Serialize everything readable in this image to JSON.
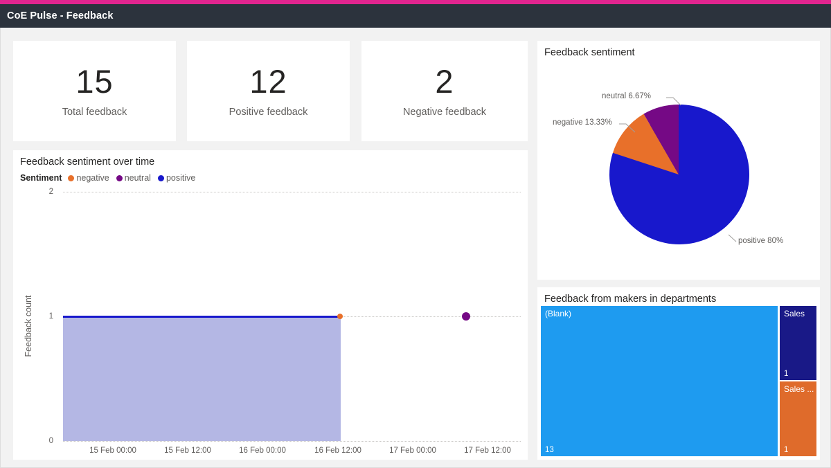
{
  "window": {
    "title": "CoE Pulse - Feedback",
    "accent_color": "#e2258f",
    "titlebar_color": "#2c333d"
  },
  "colors": {
    "negative": "#E8702A",
    "neutral": "#750985",
    "positive": "#1818CC",
    "area_fill": "#9fa3dd",
    "treemap_blank": "#1E9BF0",
    "treemap_sales": "#191987",
    "treemap_sales_other": "#DF6B2B",
    "page_background": "#f2f2f2"
  },
  "kpis": [
    {
      "value": "15",
      "label": "Total feedback",
      "name": "total-feedback"
    },
    {
      "value": "12",
      "label": "Positive feedback",
      "name": "positive-feedback"
    },
    {
      "value": "2",
      "label": "Negative feedback",
      "name": "negative-feedback"
    }
  ],
  "over_time": {
    "title": "Feedback sentiment over time",
    "legend_title": "Sentiment",
    "legend": [
      {
        "label": "negative",
        "color": "#E8702A"
      },
      {
        "label": "neutral",
        "color": "#750985"
      },
      {
        "label": "positive",
        "color": "#1818CC"
      }
    ]
  },
  "pie": {
    "title": "Feedback sentiment",
    "labels": {
      "neutral": "neutral 6.67%",
      "negative": "negative 13.33%",
      "positive": "positive 80%"
    }
  },
  "treemap": {
    "title": "Feedback from makers in departments"
  },
  "chart_data": [
    {
      "id": "feedback-sentiment-over-time",
      "type": "area",
      "title": "Feedback sentiment over time",
      "xlabel": "",
      "ylabel": "Feedback count",
      "ylim": [
        0,
        2
      ],
      "yticks": [
        "0",
        "1",
        "2"
      ],
      "xticks": [
        "15 Feb 00:00",
        "15 Feb 12:00",
        "16 Feb 00:00",
        "16 Feb 12:00",
        "17 Feb 00:00",
        "17 Feb 12:00"
      ],
      "grid": true,
      "legend_position": "top-left",
      "series": [
        {
          "name": "negative",
          "color": "#E8702A",
          "points": [
            {
              "x": "16 Feb 12:00",
              "y": 1
            }
          ]
        },
        {
          "name": "neutral",
          "color": "#750985",
          "points": [
            {
              "x": "17 Feb 12:00",
              "y": 1
            }
          ]
        },
        {
          "name": "positive",
          "color": "#1818CC",
          "points": [
            {
              "x": "14 Feb 18:00",
              "y": 1
            },
            {
              "x": "16 Feb 12:00",
              "y": 1
            }
          ]
        }
      ]
    },
    {
      "id": "feedback-sentiment-pie",
      "type": "pie",
      "title": "Feedback sentiment",
      "categories": [
        "positive",
        "negative",
        "neutral"
      ],
      "values": [
        80,
        13.33,
        6.67
      ],
      "value_labels": [
        "positive 80%",
        "negative 13.33%",
        "neutral 6.67%"
      ],
      "colors": [
        "#1818CC",
        "#E8702A",
        "#750985"
      ],
      "legend_position": "callout-labels"
    },
    {
      "id": "feedback-from-makers-in-departments",
      "type": "treemap",
      "title": "Feedback from makers in departments",
      "categories": [
        "(Blank)",
        "Sales",
        "Sales ..."
      ],
      "values": [
        13,
        1,
        1
      ],
      "value_labels": [
        "13",
        "1",
        "1"
      ],
      "colors": [
        "#1E9BF0",
        "#191987",
        "#DF6B2B"
      ]
    }
  ]
}
